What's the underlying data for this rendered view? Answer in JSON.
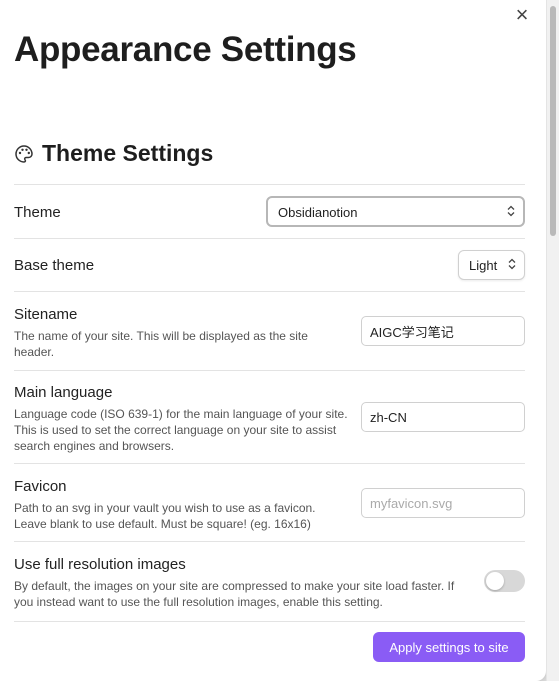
{
  "modal": {
    "close_glyph": "×",
    "title": "Appearance Settings",
    "section_title": "Theme Settings",
    "apply_label": "Apply settings to site"
  },
  "settings": {
    "theme": {
      "label": "Theme",
      "value": "Obsidianotion"
    },
    "base_theme": {
      "label": "Base theme",
      "value": "Light"
    },
    "sitename": {
      "label": "Sitename",
      "description": "The name of your site. This will be displayed as the site header.",
      "value": "AIGC学习笔记"
    },
    "main_language": {
      "label": "Main language",
      "description": "Language code (ISO 639-1) for the main language of your site. This is used to set the correct language on your site to assist search engines and browsers.",
      "value": "zh-CN"
    },
    "favicon": {
      "label": "Favicon",
      "description": "Path to an svg in your vault you wish to use as a favicon. Leave blank to use default. Must be square! (eg. 16x16)",
      "value": "",
      "placeholder": "myfavicon.svg"
    },
    "full_res": {
      "label": "Use full resolution images",
      "description": "By default, the images on your site are compressed to make your site load faster. If you instead want to use the full resolution images, enable this setting.",
      "enabled": false
    }
  },
  "icons": {
    "close": "close-icon",
    "section": "palette-icon",
    "select_chevron": "chevron-up-down-icon"
  },
  "colors": {
    "accent": "#8a5cf5",
    "toggle_off": "#d8d8d8"
  }
}
